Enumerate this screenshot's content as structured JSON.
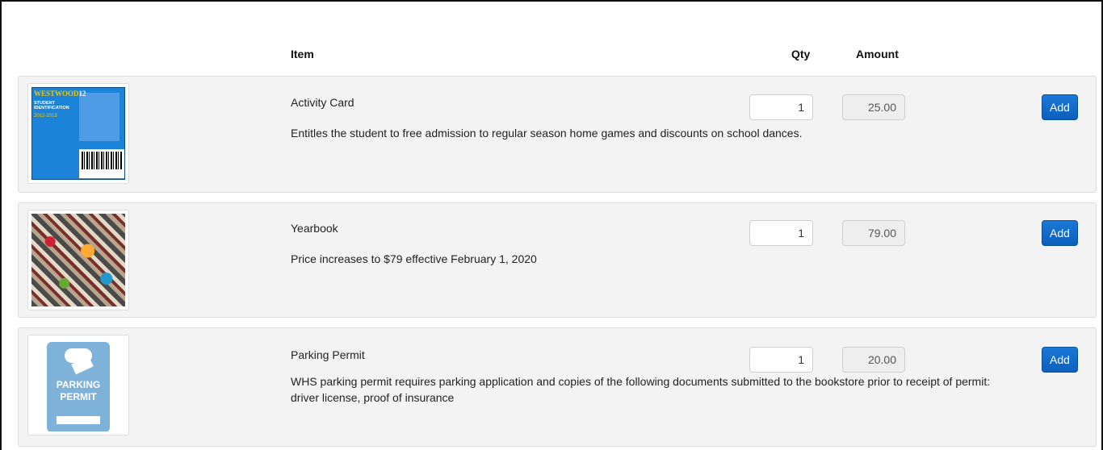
{
  "header": {
    "item_label": "Item",
    "qty_label": "Qty",
    "amount_label": "Amount"
  },
  "items": [
    {
      "title": "Activity Card",
      "description": "Entitles the student to free admission to regular season home games and discounts on school dances.",
      "qty": "1",
      "amount": "25.00",
      "button_label": "Add",
      "image": {
        "icon": "id-card-image",
        "line1": "WESTWOOD",
        "line1b": "12",
        "line2": "STUDENT",
        "line3": "IDENTIFICATION",
        "line4": "2012-2013"
      }
    },
    {
      "title": "Yearbook",
      "description": "Price increases to $79 effective February 1, 2020",
      "qty": "1",
      "amount": "79.00",
      "button_label": "Add",
      "image": {
        "icon": "yearbook-image"
      }
    },
    {
      "title": "Parking Permit",
      "description": "WHS parking permit requires parking application and copies of the following documents submitted to the bookstore prior to receipt of permit: driver license, proof of insurance",
      "qty": "1",
      "amount": "20.00",
      "button_label": "Add",
      "image": {
        "icon": "parking-permit-image",
        "line1": "PARKING",
        "line2": "PERMIT"
      }
    }
  ],
  "colors": {
    "row_bg": "#f3f3f3",
    "button_bg": "#1a78d6",
    "amount_bg": "#eeeeee"
  }
}
